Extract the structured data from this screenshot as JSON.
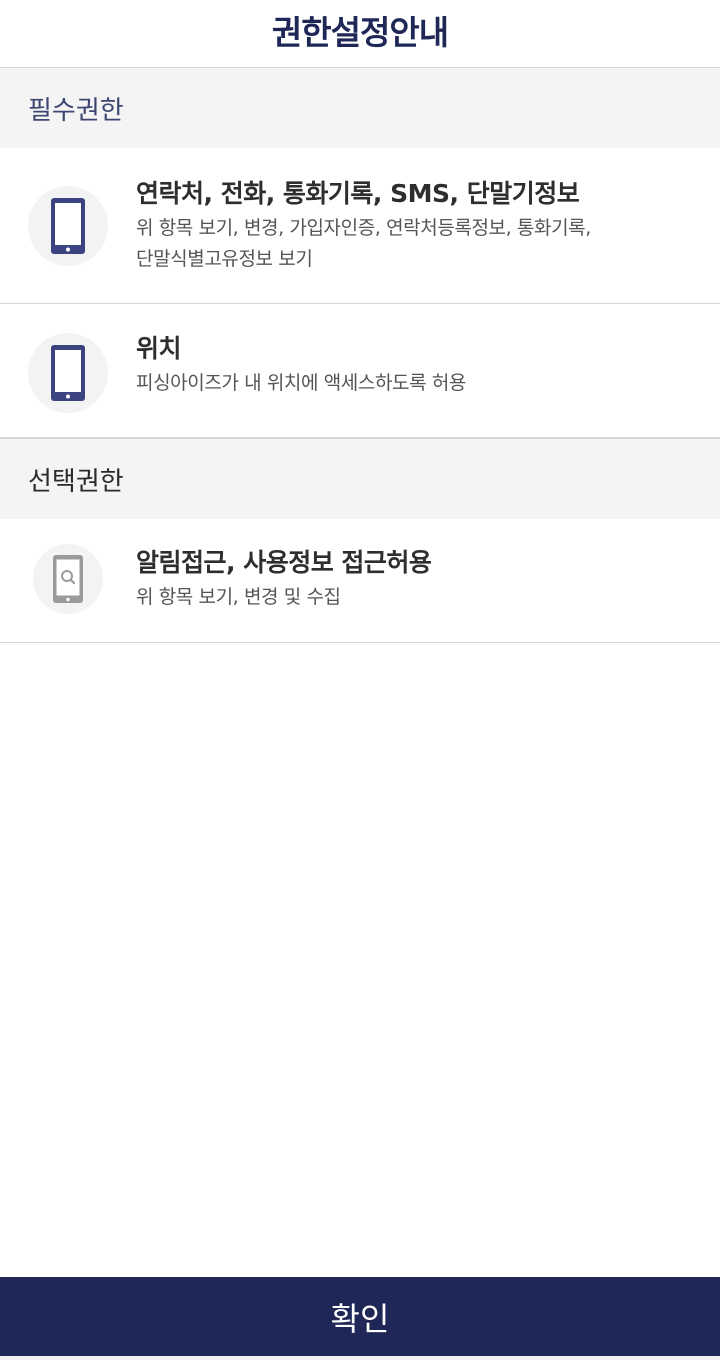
{
  "header": {
    "title": "권한설정안내"
  },
  "sections": {
    "required": {
      "label": "필수권한",
      "items": [
        {
          "icon": "tablet-icon",
          "title": "연락처, 전화, 통화기록, SMS, 단말기정보",
          "desc_line1": "위 항목 보기, 변경, 가입자인증, 연락처등록정보, 통화기록,",
          "desc_line2": "단말식별고유정보 보기"
        },
        {
          "icon": "tablet-icon",
          "title": "위치",
          "desc_line1": "피싱아이즈가 내 위치에 액세스하도록 허용"
        }
      ]
    },
    "optional": {
      "label": "선택권한",
      "items": [
        {
          "icon": "phone-search-icon",
          "title": "알림접근, 사용정보 접근허용",
          "desc_line1": "위 항목 보기, 변경 및 수집"
        }
      ]
    }
  },
  "footer": {
    "confirm_label": "확인"
  },
  "colors": {
    "brand_navy": "#1f2757",
    "icon_navy": "#3b4381",
    "icon_gray": "#9a9a9a",
    "section_bg": "#f4f4f4"
  }
}
